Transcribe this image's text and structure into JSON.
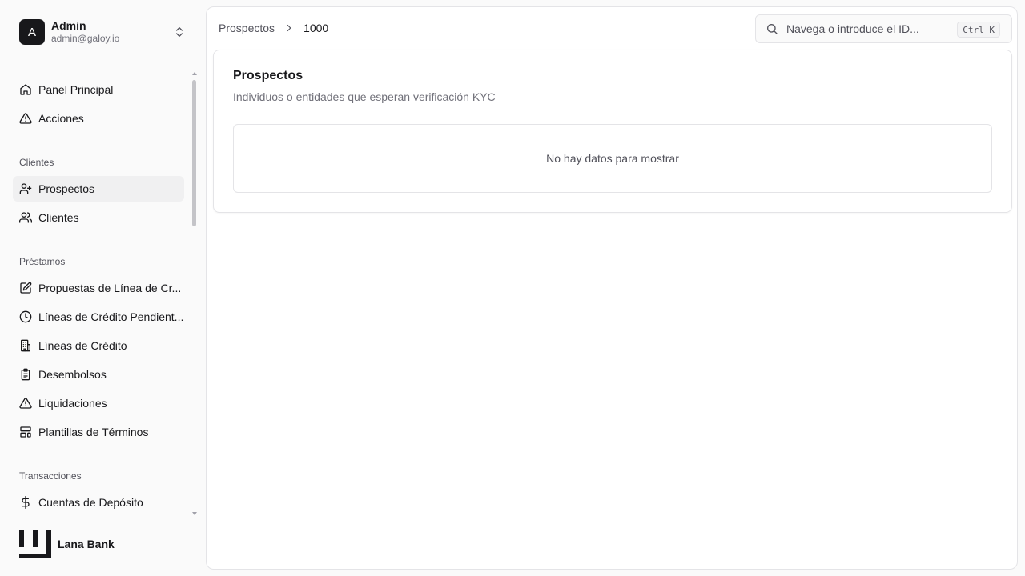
{
  "user": {
    "initial": "A",
    "name": "Admin",
    "email": "admin@galoy.io"
  },
  "nav": {
    "items_top": [
      {
        "label": "Panel Principal",
        "icon": "home-icon"
      },
      {
        "label": "Acciones",
        "icon": "alert-triangle-icon"
      }
    ],
    "groups": [
      {
        "title": "Clientes",
        "items": [
          {
            "label": "Prospectos",
            "icon": "user-plus-icon",
            "active": true
          },
          {
            "label": "Clientes",
            "icon": "users-icon"
          }
        ]
      },
      {
        "title": "Préstamos",
        "items": [
          {
            "label": "Propuestas de Línea de Cr...",
            "icon": "edit-document-icon"
          },
          {
            "label": "Líneas de Crédito Pendient...",
            "icon": "clock-icon"
          },
          {
            "label": "Líneas de Crédito",
            "icon": "building-icon"
          },
          {
            "label": "Desembolsos",
            "icon": "clipboard-icon"
          },
          {
            "label": "Liquidaciones",
            "icon": "alert-triangle-icon"
          },
          {
            "label": "Plantillas de Términos",
            "icon": "layout-template-icon"
          }
        ]
      },
      {
        "title": "Transacciones",
        "items": [
          {
            "label": "Cuentas de Depósito",
            "icon": "dollar-icon"
          }
        ]
      }
    ]
  },
  "brand": {
    "name": "Lana Bank"
  },
  "breadcrumb": {
    "parent": "Prospectos",
    "current": "1000"
  },
  "search": {
    "placeholder": "Navega o introduce el ID...",
    "shortcut": "Ctrl K"
  },
  "card": {
    "title": "Prospectos",
    "description": "Individuos o entidades que esperan verificación KYC",
    "empty_text": "No hay datos para mostrar"
  },
  "colors": {
    "accent": "#18181b",
    "active_bg": "#f0f0f1",
    "border": "#e4e4e7"
  }
}
